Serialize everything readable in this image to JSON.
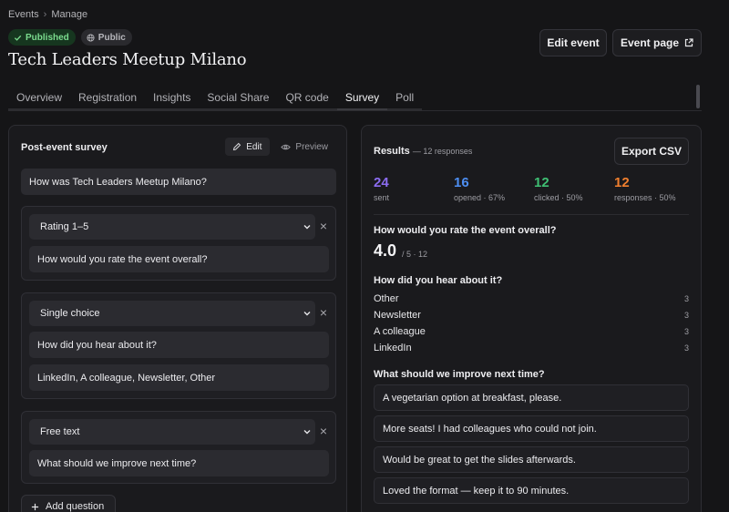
{
  "breadcrumb": {
    "items": [
      "Events",
      "Manage"
    ],
    "separator": "›"
  },
  "badges": {
    "published": "Published",
    "public": "Public"
  },
  "event": {
    "title": "Tech Leaders Meetup Milano"
  },
  "header_buttons": {
    "edit_event": "Edit event",
    "event_page": "Event page"
  },
  "tabs": [
    {
      "label": "Overview"
    },
    {
      "label": "Registration"
    },
    {
      "label": "Insights"
    },
    {
      "label": "Social Share"
    },
    {
      "label": "QR code"
    },
    {
      "label": "Survey"
    },
    {
      "label": "Poll"
    }
  ],
  "active_tab": "Survey",
  "survey": {
    "title": "Post-event survey",
    "edit_label": "Edit",
    "preview_label": "Preview",
    "survey_name": "How was Tech Leaders Meetup Milano?",
    "questions": [
      {
        "type": "Rating 1–5",
        "prompt": "How would you rate the event overall?"
      },
      {
        "type": "Single choice",
        "prompt": "How did you hear about it?",
        "options": "LinkedIn, A colleague, Newsletter, Other"
      },
      {
        "type": "Free text",
        "prompt": "What should we improve next time?"
      }
    ],
    "add_question": "Add question"
  },
  "results": {
    "title": "Results",
    "subtitle": "— 12 responses",
    "export_label": "Export CSV",
    "stats": [
      {
        "value": "24",
        "label": "sent",
        "color": "#8b6cf0"
      },
      {
        "value": "16",
        "label": "opened · 67%",
        "color": "#4d8ef2"
      },
      {
        "value": "12",
        "label": "clicked · 50%",
        "color": "#3fbf73"
      },
      {
        "value": "12",
        "label": "responses · 50%",
        "color": "#f07f2e"
      }
    ],
    "rating_question": "How would you rate the event overall?",
    "rating_value": "4.0",
    "rating_sub": "/ 5 · 12",
    "choice_question": "How did you hear about it?",
    "choice_options": [
      {
        "label": "Other",
        "count": "3"
      },
      {
        "label": "Newsletter",
        "count": "3"
      },
      {
        "label": "A colleague",
        "count": "3"
      },
      {
        "label": "LinkedIn",
        "count": "3"
      }
    ],
    "text_question": "What should we improve next time?",
    "text_answers": [
      "A vegetarian option at breakfast, please.",
      "More seats! I had colleagues who could not join.",
      "Would be great to get the slides afterwards.",
      "Loved the format — keep it to 90 minutes."
    ]
  },
  "icons": {
    "check": "check-icon",
    "globe": "globe-icon",
    "external": "external-link-icon",
    "pencil": "pencil-icon",
    "eye": "eye-icon",
    "chevron": "chevron-down-icon",
    "close": "close-icon",
    "plus": "plus-icon"
  }
}
